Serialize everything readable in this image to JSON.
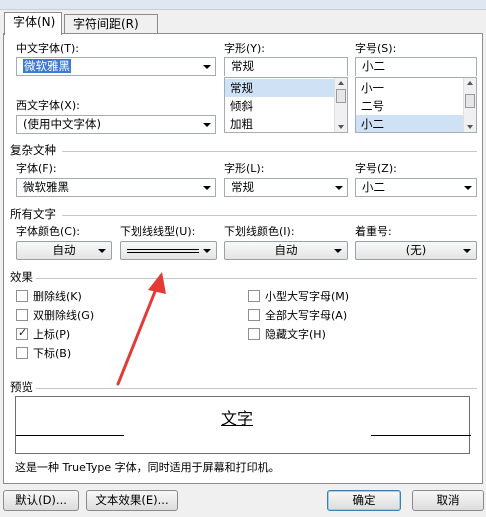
{
  "tabs": [
    "字体(N)",
    "字符间距(R)"
  ],
  "chinese_font": {
    "label": "中文字体(T):",
    "value": "微软雅黑"
  },
  "style": {
    "label": "字形(Y):",
    "value": "常规",
    "options": [
      "常规",
      "倾斜",
      "加粗"
    ]
  },
  "size": {
    "label": "字号(S):",
    "value": "小二",
    "options": [
      "小一",
      "二号",
      "小二"
    ]
  },
  "western_font": {
    "label": "西文字体(X):",
    "value": "(使用中文字体)"
  },
  "complex": {
    "section": "复杂文种",
    "font_label": "字体(F):",
    "font_value": "微软雅黑",
    "style_label": "字形(L):",
    "style_value": "常规",
    "size_label": "字号(Z):",
    "size_value": "小二"
  },
  "all_text": {
    "section": "所有文字",
    "color_label": "字体颜色(C):",
    "color_value": "自动",
    "underline_type_label": "下划线线型(U):",
    "underline_color_label": "下划线颜色(I):",
    "underline_color_value": "自动",
    "emphasis_label": "着重号:",
    "emphasis_value": "(无)"
  },
  "effects": {
    "section": "效果",
    "items": [
      {
        "label": "删除线(K)",
        "checked": false
      },
      {
        "label": "双删除线(G)",
        "checked": false
      },
      {
        "label": "上标(P)",
        "checked": true
      },
      {
        "label": "下标(B)",
        "checked": false
      },
      {
        "label": "小型大写字母(M)",
        "checked": false
      },
      {
        "label": "全部大写字母(A)",
        "checked": false
      },
      {
        "label": "隐藏文字(H)",
        "checked": false
      }
    ]
  },
  "preview": {
    "section": "预览",
    "sample": "文字",
    "note": "这是一种 TrueType 字体，同时适用于屏幕和打印机。"
  },
  "buttons": {
    "default": "默认(D)...",
    "text_effects": "文本效果(E)...",
    "ok": "确定",
    "cancel": "取消"
  },
  "colors": {
    "selection": "#3d7bd1",
    "arrow": "#e53935",
    "default_border": "#3c7fb1"
  }
}
